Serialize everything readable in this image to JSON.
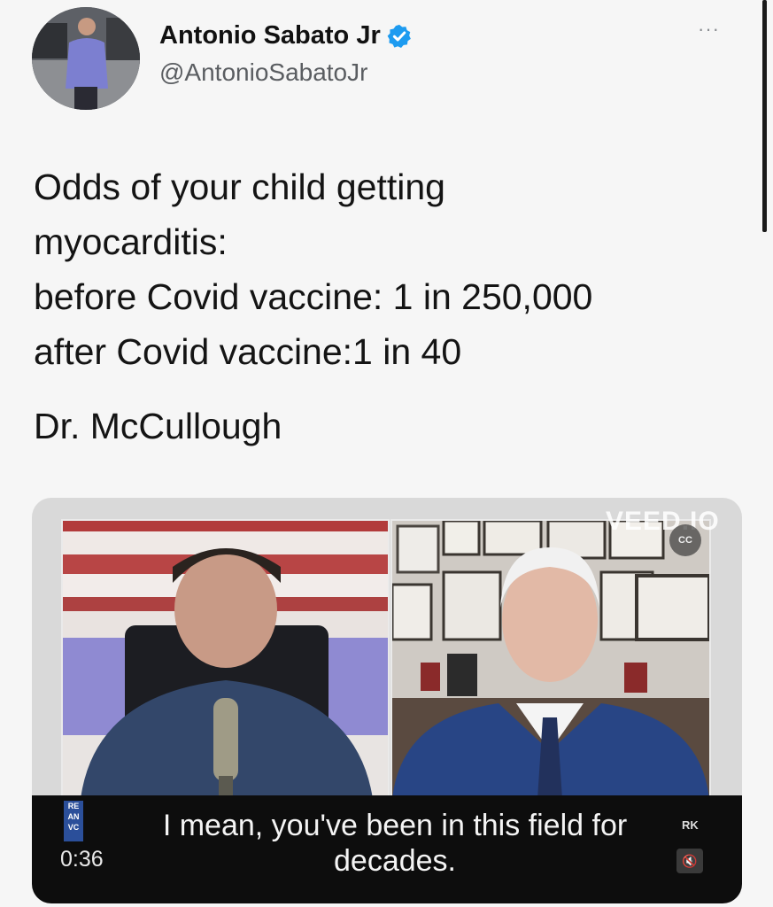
{
  "author": {
    "display_name": "Antonio Sabato Jr",
    "handle": "@AntonioSabatoJr",
    "verified": true,
    "more_label": "···"
  },
  "tweet": {
    "lines": [
      "Odds of your child getting",
      "myocarditis:",
      "before Covid vaccine: 1 in 250,000",
      "after Covid vaccine:1 in 40"
    ],
    "signature": "Dr. McCullough"
  },
  "video": {
    "watermark": "VEED.IO",
    "cc_label": "CC",
    "caption_lines": [
      "I mean, you've been in this field for",
      "decades."
    ],
    "timestamp": "0:36",
    "right_tag": "RK",
    "mute_icon": "🔇",
    "left_tag": "RE AN VC"
  },
  "colors": {
    "verified_badge": "#1d9bf0",
    "caption_bar": "#0d0d0d"
  },
  "icons": {
    "verified": "verified-badge-icon",
    "more": "more-options-icon",
    "cc": "closed-captions-icon",
    "mute": "mute-icon"
  }
}
